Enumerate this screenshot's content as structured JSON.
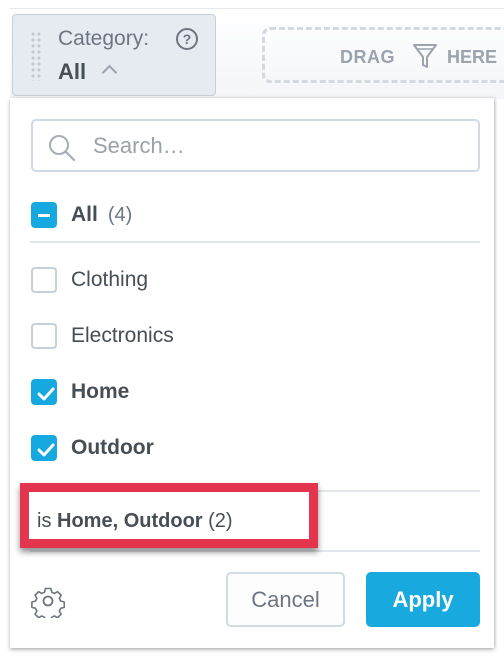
{
  "filter_button": {
    "label": "Category:",
    "value": "All"
  },
  "drop_zone": {
    "text_left": "DRAG",
    "text_right": "HERE",
    "icon": "funnel-icon"
  },
  "search": {
    "placeholder": "Search…",
    "value": ""
  },
  "select_all": {
    "label": "All",
    "count": "(4)",
    "state": "partial"
  },
  "items": [
    {
      "label": "Clothing",
      "checked": false
    },
    {
      "label": "Electronics",
      "checked": false
    },
    {
      "label": "Home",
      "checked": true
    },
    {
      "label": "Outdoor",
      "checked": true
    }
  ],
  "summary": {
    "prefix": "is",
    "values": "Home, Outdoor",
    "count": "(2)"
  },
  "footer": {
    "cancel_label": "Cancel",
    "apply_label": "Apply"
  },
  "colors": {
    "accent": "#16a9df",
    "highlight": "#e4354f"
  }
}
